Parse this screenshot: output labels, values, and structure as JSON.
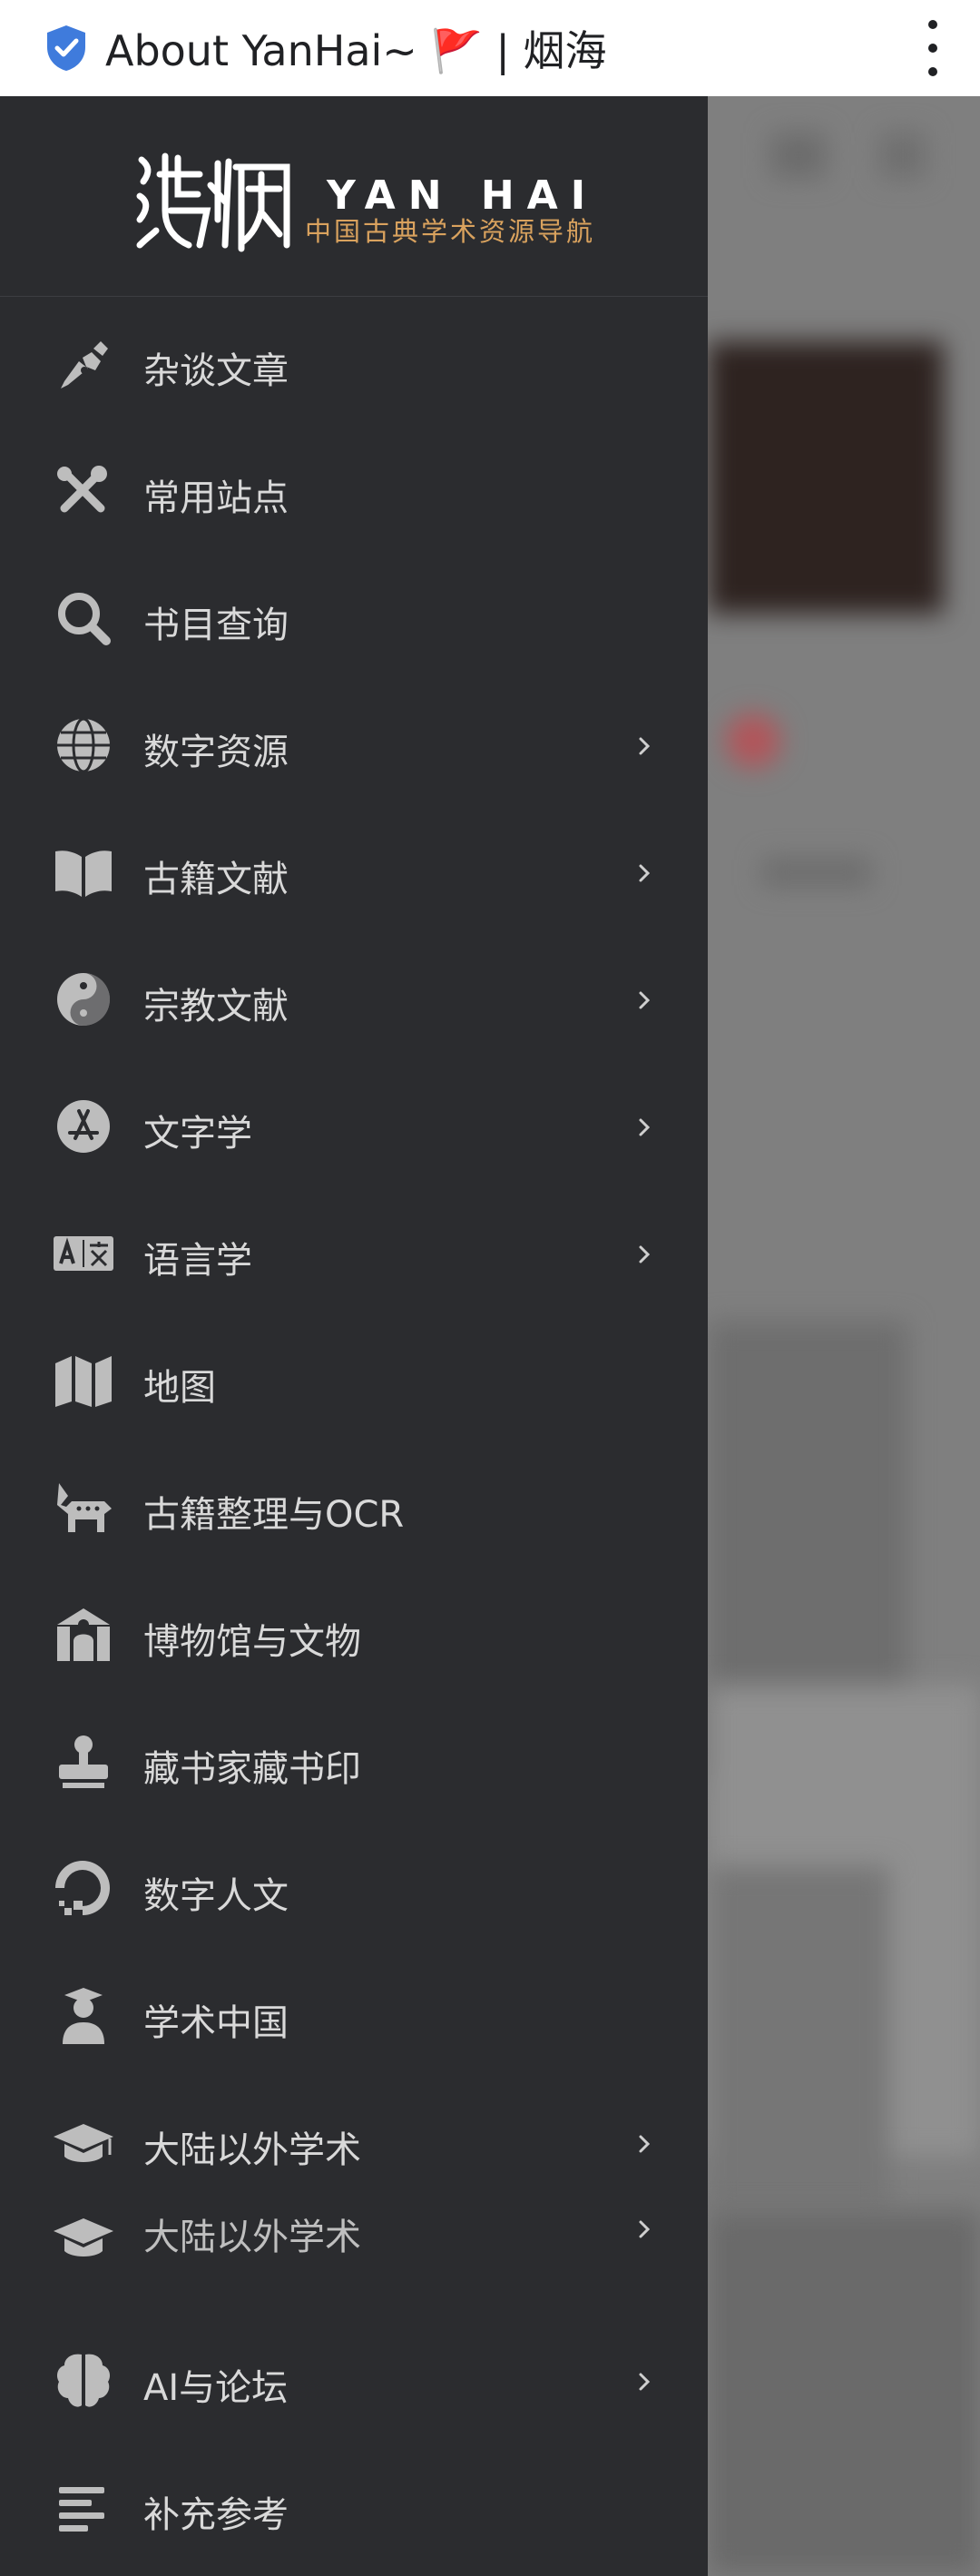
{
  "page": {
    "title": "About YanHai~ 🚩 | 烟海",
    "accent": "#3f7bdc",
    "drawer_bg": "#2b2c2f",
    "brand_gold": "#d9a25e"
  },
  "brand": {
    "logo_text": "烟海",
    "name_en": "YAN HAI",
    "subtitle": "中国古典学术资源导航"
  },
  "nav": [
    {
      "label": "杂谈文章",
      "icon": "pen-nib-icon",
      "submenu": false
    },
    {
      "label": "常用站点",
      "icon": "tools-icon",
      "submenu": false
    },
    {
      "label": "书目查询",
      "icon": "search-icon",
      "submenu": false
    },
    {
      "label": "数字资源",
      "icon": "globe-icon",
      "submenu": true
    },
    {
      "label": "古籍文献",
      "icon": "book-open-icon",
      "submenu": true
    },
    {
      "label": "宗教文献",
      "icon": "yin-yang-icon",
      "submenu": true
    },
    {
      "label": "文字学",
      "icon": "app-store-icon",
      "submenu": true
    },
    {
      "label": "语言学",
      "icon": "language-icon",
      "submenu": true
    },
    {
      "label": "地图",
      "icon": "map-icon",
      "submenu": false
    },
    {
      "label": "古籍整理与OCR",
      "icon": "donkey-icon",
      "submenu": false
    },
    {
      "label": "博物馆与文物",
      "icon": "museum-icon",
      "submenu": false
    },
    {
      "label": "藏书家藏书印",
      "icon": "stamp-icon",
      "submenu": false
    },
    {
      "label": "数字人文",
      "icon": "digital-ocean-icon",
      "submenu": false
    },
    {
      "label": "学术中国",
      "icon": "graduate-user-icon",
      "submenu": false
    },
    {
      "label": "大陆以外学术",
      "icon": "graduation-cap-icon",
      "submenu": true
    },
    {
      "label": "大陆以外学术",
      "icon": "graduation-cap-icon",
      "submenu": true
    },
    {
      "label": "AI与论坛",
      "icon": "brain-icon",
      "submenu": true
    },
    {
      "label": "补充参考",
      "icon": "align-left-icon",
      "submenu": false
    }
  ]
}
